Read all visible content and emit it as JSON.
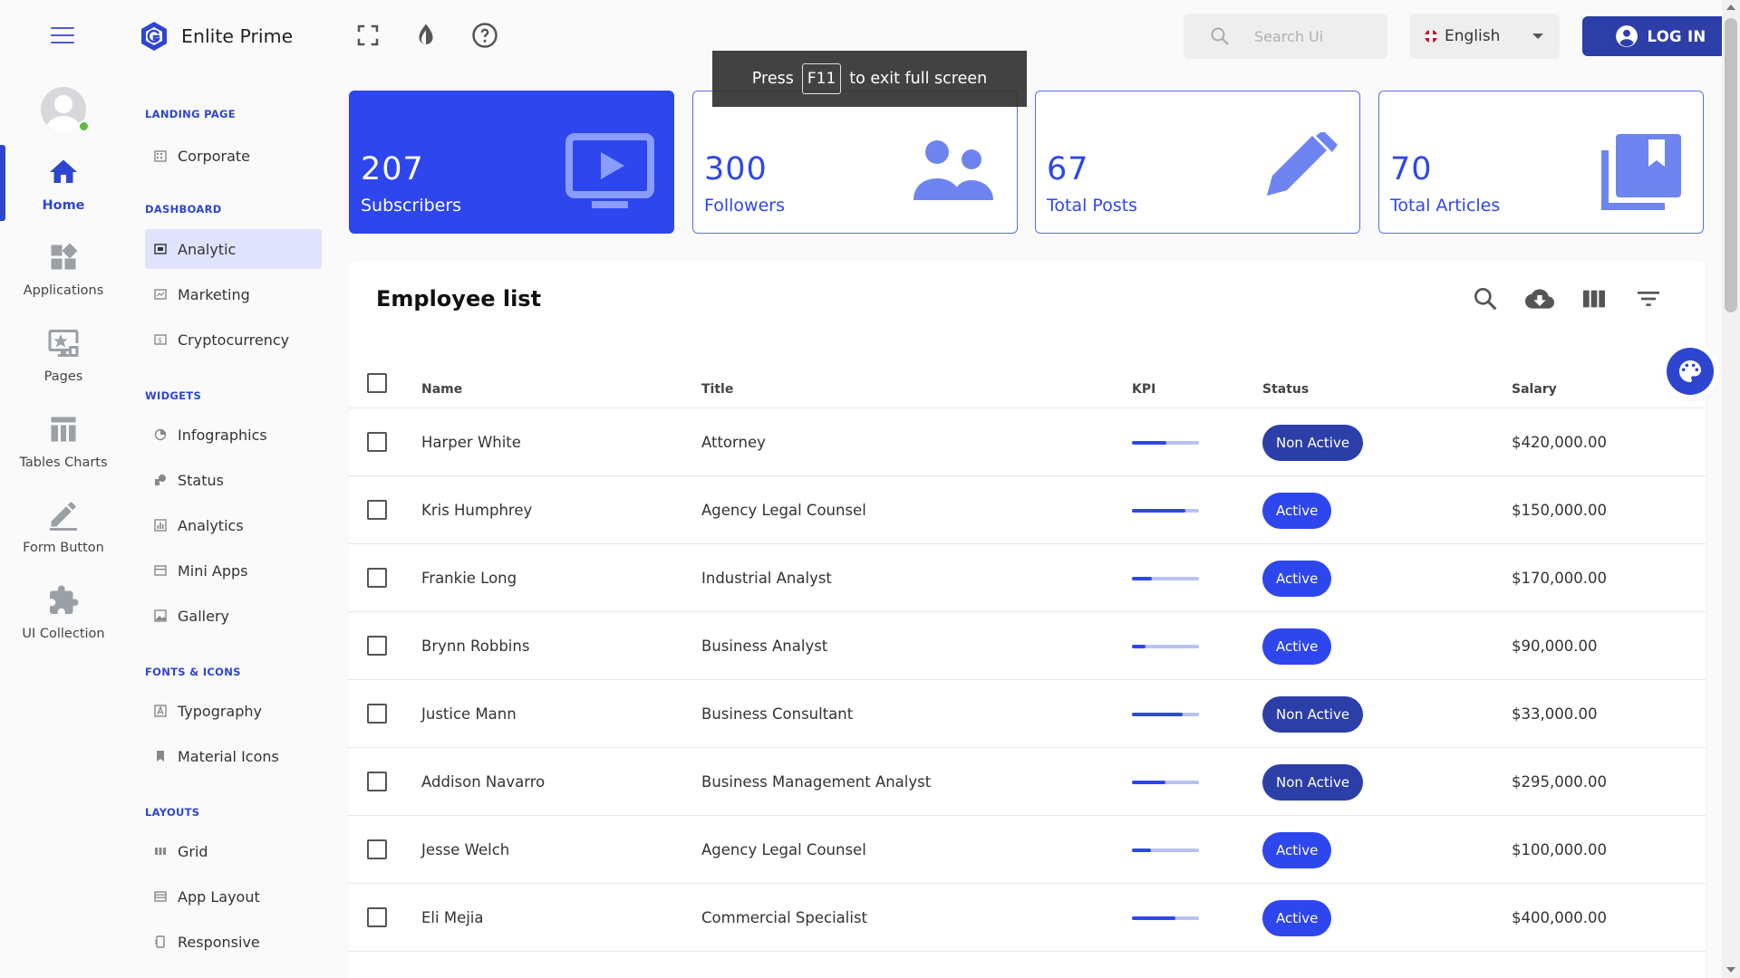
{
  "brand": {
    "name": "Enlite Prime"
  },
  "rail": {
    "items": [
      {
        "label": "Home",
        "icon": "home-icon",
        "active": true
      },
      {
        "label": "Applications",
        "icon": "widgets-icon"
      },
      {
        "label": "Pages",
        "icon": "desktop-pages-icon"
      },
      {
        "label": "Tables Charts",
        "icon": "table-icon"
      },
      {
        "label": "Form Button",
        "icon": "pencil-icon"
      },
      {
        "label": "UI Collection",
        "icon": "puzzle-icon"
      }
    ]
  },
  "subnav": {
    "sections": [
      {
        "title": "LANDING PAGE",
        "items": [
          {
            "label": "Corporate",
            "icon": "building-icon"
          }
        ]
      },
      {
        "title": "DASHBOARD",
        "items": [
          {
            "label": "Analytic",
            "icon": "analytic-icon",
            "active": true
          },
          {
            "label": "Marketing",
            "icon": "marketing-icon"
          },
          {
            "label": "Cryptocurrency",
            "icon": "crypto-icon"
          }
        ]
      },
      {
        "title": "WIDGETS",
        "items": [
          {
            "label": "Infographics",
            "icon": "infographics-icon"
          },
          {
            "label": "Status",
            "icon": "status-icon"
          },
          {
            "label": "Analytics",
            "icon": "analytics-icon"
          },
          {
            "label": "Mini Apps",
            "icon": "mini-apps-icon"
          },
          {
            "label": "Gallery",
            "icon": "gallery-icon"
          }
        ]
      },
      {
        "title": "FONTS & ICONS",
        "items": [
          {
            "label": "Typography",
            "icon": "typography-icon"
          },
          {
            "label": "Material Icons",
            "icon": "bookmark-icon"
          }
        ]
      },
      {
        "title": "LAYOUTS",
        "items": [
          {
            "label": "Grid",
            "icon": "grid-icon"
          },
          {
            "label": "App Layout",
            "icon": "app-layout-icon"
          },
          {
            "label": "Responsive",
            "icon": "responsive-icon"
          }
        ]
      }
    ]
  },
  "header": {
    "search_placeholder": "Search Ui",
    "language": "English",
    "login_label": "LOG IN"
  },
  "toast": {
    "before": "Press",
    "key": "F11",
    "after": "to exit full screen"
  },
  "stats": [
    {
      "value": "207",
      "label": "Subscribers",
      "icon": "video-icon",
      "filled": true
    },
    {
      "value": "300",
      "label": "Followers",
      "icon": "people-icon"
    },
    {
      "value": "67",
      "label": "Total Posts",
      "icon": "pencil-icon"
    },
    {
      "value": "70",
      "label": "Total Articles",
      "icon": "library-books-icon"
    }
  ],
  "table": {
    "title": "Employee list",
    "columns": [
      "Name",
      "Title",
      "KPI",
      "Status",
      "Salary"
    ],
    "rows": [
      {
        "name": "Harper White",
        "title": "Attorney",
        "kpi": 0.52,
        "status": "Non Active",
        "salary": "$420,000.00"
      },
      {
        "name": "Kris Humphrey",
        "title": "Agency Legal Counsel",
        "kpi": 0.8,
        "status": "Active",
        "salary": "$150,000.00"
      },
      {
        "name": "Frankie Long",
        "title": "Industrial Analyst",
        "kpi": 0.3,
        "status": "Active",
        "salary": "$170,000.00"
      },
      {
        "name": "Brynn Robbins",
        "title": "Business Analyst",
        "kpi": 0.2,
        "status": "Active",
        "salary": "$90,000.00"
      },
      {
        "name": "Justice Mann",
        "title": "Business Consultant",
        "kpi": 0.75,
        "status": "Non Active",
        "salary": "$33,000.00"
      },
      {
        "name": "Addison Navarro",
        "title": "Business Management Analyst",
        "kpi": 0.5,
        "status": "Non Active",
        "salary": "$295,000.00"
      },
      {
        "name": "Jesse Welch",
        "title": "Agency Legal Counsel",
        "kpi": 0.28,
        "status": "Active",
        "salary": "$100,000.00"
      },
      {
        "name": "Eli Mejia",
        "title": "Commercial Specialist",
        "kpi": 0.65,
        "status": "Active",
        "salary": "$400,000.00"
      }
    ]
  },
  "colors": {
    "primary": "#2e46ee",
    "dark_primary": "#2c3ea8",
    "online": "#5fba3c"
  }
}
